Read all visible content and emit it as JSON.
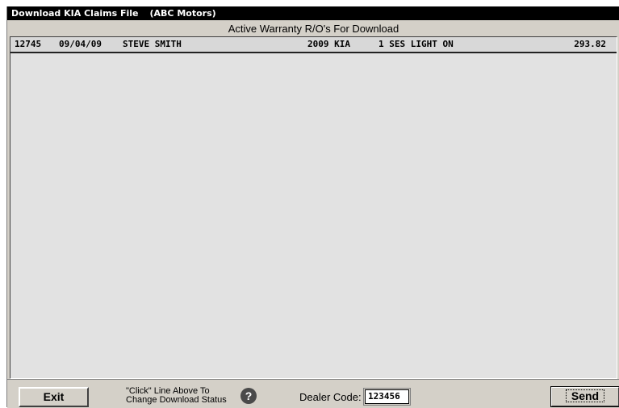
{
  "window": {
    "title": "Download KIA Claims File",
    "dealer_name": "(ABC Motors)"
  },
  "list": {
    "header": "Active Warranty R/O's For Download",
    "rows": [
      {
        "ro": "12745",
        "date": "09/04/09",
        "customer": "STEVE SMITH",
        "vehicle": "2009 KIA",
        "description": "1 SES LIGHT ON",
        "amount": "293.82"
      }
    ]
  },
  "footer": {
    "exit_label": "Exit",
    "hint_line1": "\"Click\" Line Above To",
    "hint_line2": "Change Download Status",
    "help_glyph": "?",
    "dealer_code_label": "Dealer Code:",
    "dealer_code_value": "123456",
    "send_label": "Send"
  }
}
